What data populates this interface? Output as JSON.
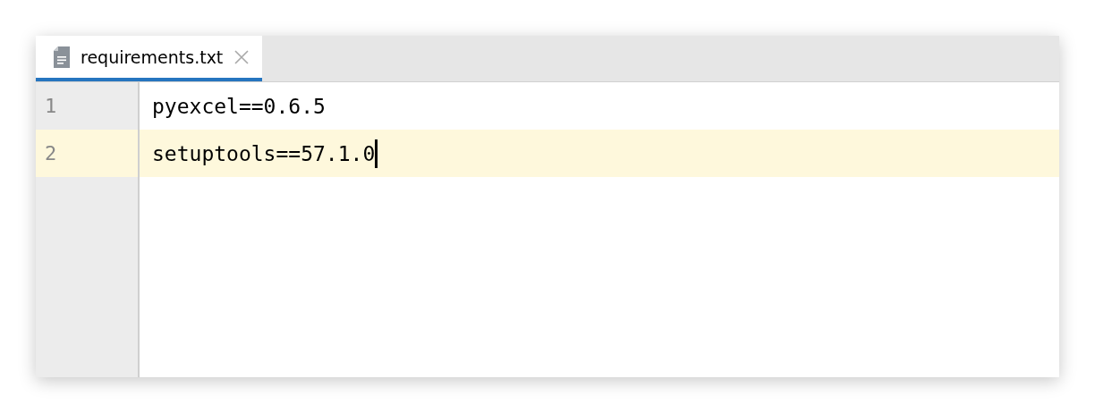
{
  "tabs": [
    {
      "label": "requirements.txt",
      "selected": true,
      "closable": true
    }
  ],
  "lines": [
    {
      "number": "1",
      "text": "pyexcel==0.6.5",
      "current": false
    },
    {
      "number": "2",
      "text": "setuptools==57.1.0",
      "current": true
    }
  ]
}
